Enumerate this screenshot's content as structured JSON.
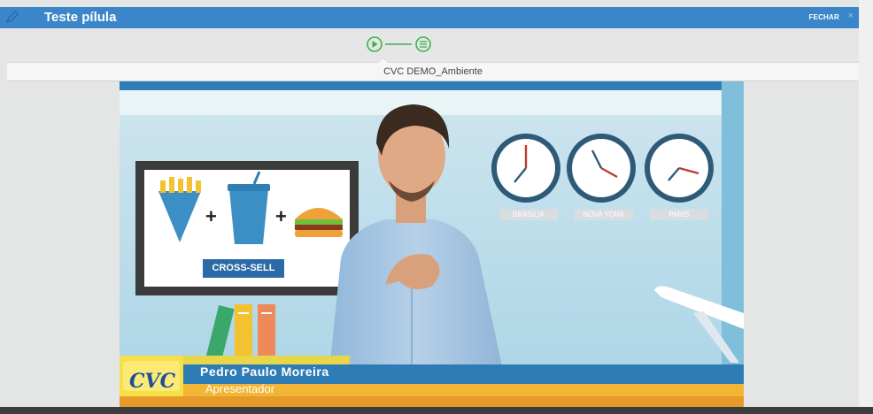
{
  "header": {
    "title": "Teste pílula",
    "close_label": "FECHAR",
    "close_icon": "×"
  },
  "stepper": {
    "steps": [
      "play-step",
      "list-step"
    ],
    "active_color": "#3cb34a"
  },
  "course": {
    "name": "CVC DEMO_Ambiente"
  },
  "video": {
    "board_label": "CROSS-SELL",
    "clocks": [
      "BRASILIA",
      "NOVA YORK",
      "PARIS"
    ],
    "presenter_name": "Pedro Paulo Moreira",
    "presenter_role": "Apresentador",
    "logo_text": "CVC"
  },
  "colors": {
    "header": "#3a86c8",
    "accent": "#3cb34a"
  }
}
